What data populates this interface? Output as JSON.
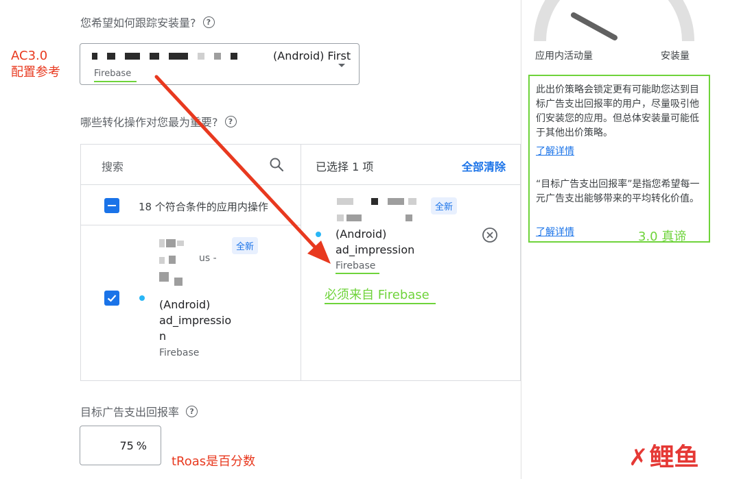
{
  "tracking": {
    "question": "您希望如何跟踪安装量?",
    "app_name": "(Android) First",
    "source": "Firebase"
  },
  "conversions": {
    "question": "哪些转化操作对您最为重要?",
    "search_placeholder": "搜索",
    "selected_count": "已选择 1 项",
    "clear_all": "全部清除",
    "group_label": "18 个符合条件的应用内操作",
    "left_item": {
      "badge": "全新",
      "line_us": "us -",
      "line_android": "(Android)",
      "line_event1": "ad_impressio",
      "line_event2": "n",
      "source": "Firebase"
    },
    "right_item": {
      "badge": "全新",
      "line_android": "(Android)",
      "line_event": "ad_impression",
      "source": "Firebase"
    }
  },
  "troas": {
    "label": "目标广告支出回报率",
    "value": "75",
    "unit": "%"
  },
  "gauge": {
    "left_label": "应用内活动量",
    "right_label": "安装量"
  },
  "info_box": {
    "para1": "此出价策略会锁定更有可能助您达到目标广告支出回报率的用户，尽量吸引他们安装您的应用。但总体安装量可能低于其他出价策略。",
    "link1": "了解详情",
    "para2": "“目标广告支出回报率”是指您希望每一元广告支出能够带来的平均转化价值。",
    "link2": "了解详情"
  },
  "annotations": {
    "ac_line1": "AC3.0",
    "ac_line2": "配置参考",
    "firebase_note": "必须来自 Firebase",
    "truth": "3.0 真谛",
    "troas_note": "tRoas是百分数"
  },
  "watermark": {
    "text": "鲤鱼"
  },
  "colors": {
    "annotation_red": "#e8391f",
    "annotation_green": "#6ed33a",
    "blue": "#1a73e8",
    "border": "#dadce0"
  }
}
